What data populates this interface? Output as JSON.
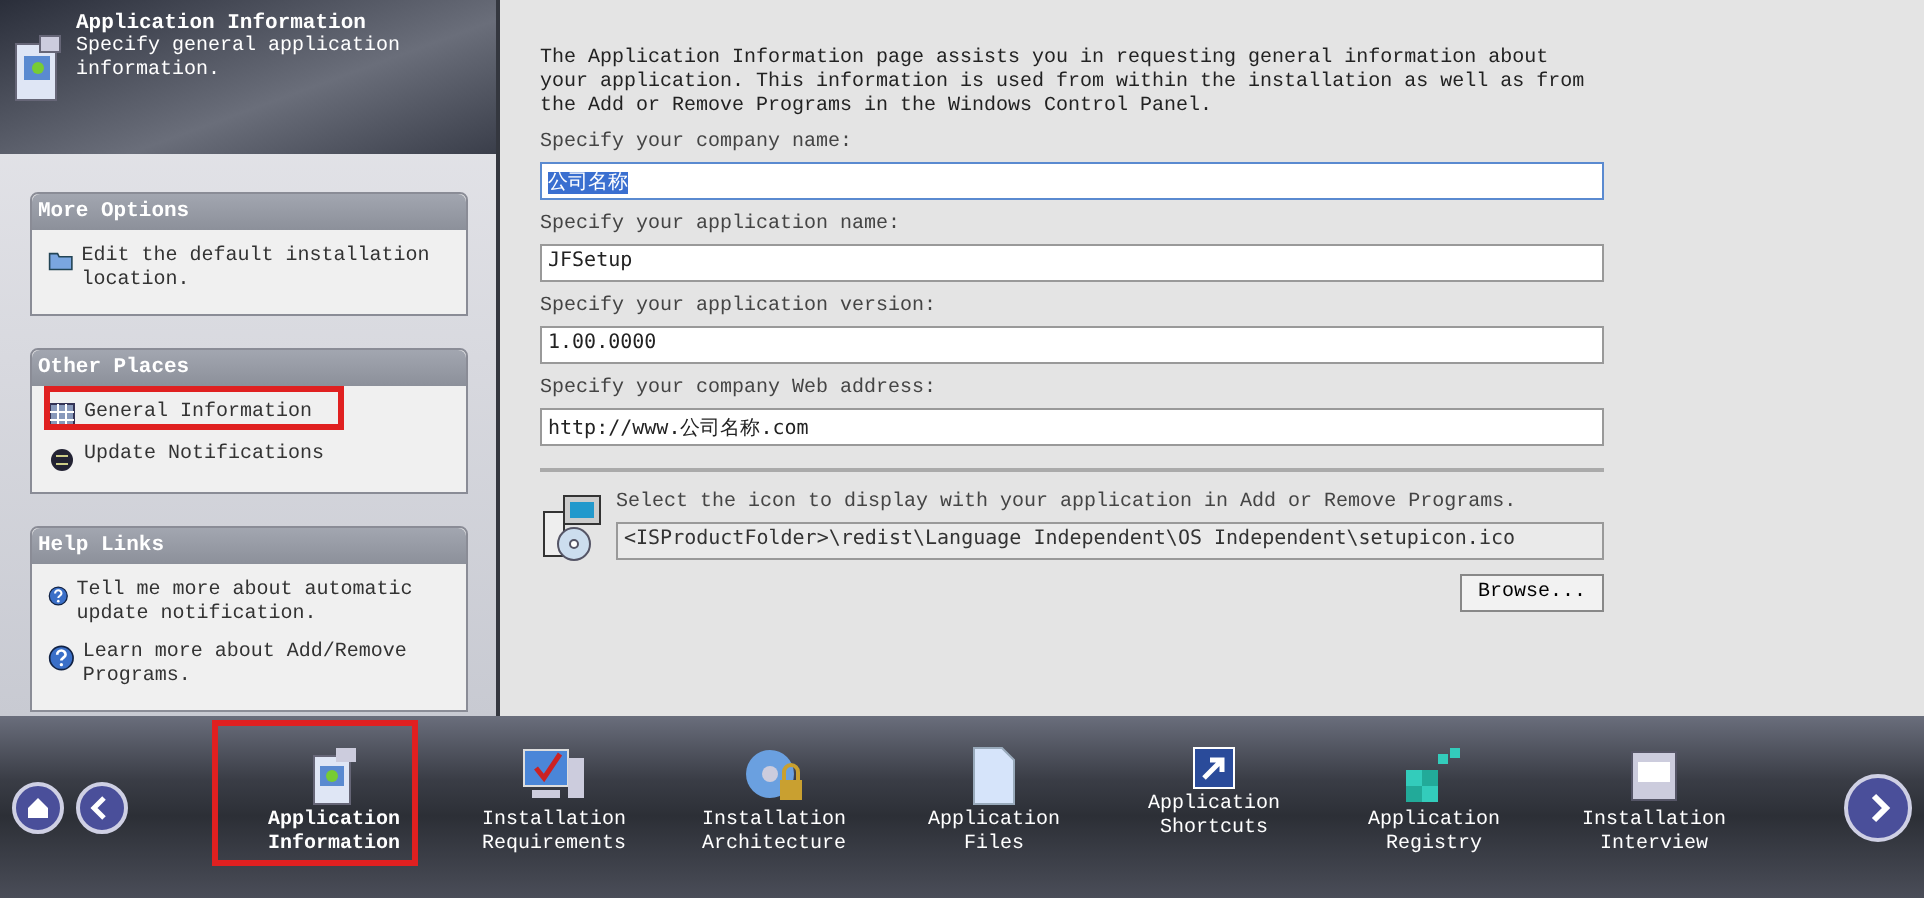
{
  "header": {
    "title": "Application Information",
    "subtitle": "Specify general application information."
  },
  "sidebar": {
    "panels": [
      {
        "title": "More Options",
        "items": [
          {
            "label": "Edit the default installation location."
          }
        ]
      },
      {
        "title": "Other Places",
        "items": [
          {
            "label": "General Information"
          },
          {
            "label": "Update Notifications"
          }
        ]
      },
      {
        "title": "Help Links",
        "items": [
          {
            "label": "Tell me more about automatic update notification."
          },
          {
            "label": "Learn more about Add/Remove Programs."
          }
        ]
      }
    ]
  },
  "main": {
    "description": "The Application Information page assists you in requesting general information about your application. This information is used from within the installation as well as from the Add or Remove Programs in the Windows Control Panel.",
    "fields": [
      {
        "label": "Specify your company name:",
        "value": "公司名称",
        "selected": true
      },
      {
        "label": "Specify your application name:",
        "value": "JFSetup",
        "selected": false
      },
      {
        "label": "Specify your application version:",
        "value": "1.00.0000",
        "selected": false
      },
      {
        "label": "Specify your company Web address:",
        "value": "http://www.公司名称.com",
        "selected": false
      }
    ],
    "icon_section": {
      "label": "Select the icon to display with your application in Add or Remove Programs.",
      "path": "<ISProductFolder>\\redist\\Language Independent\\OS Independent\\setupicon.ico",
      "button": "Browse..."
    }
  },
  "nav": {
    "items": [
      {
        "label": "Application Information",
        "selected": true
      },
      {
        "label": "Installation Requirements",
        "selected": false
      },
      {
        "label": "Installation Architecture",
        "selected": false
      },
      {
        "label": "Application Files",
        "selected": false
      },
      {
        "label": "Application Shortcuts",
        "selected": false
      },
      {
        "label": "Application Registry",
        "selected": false
      },
      {
        "label": "Installation Interview",
        "selected": false
      }
    ]
  }
}
